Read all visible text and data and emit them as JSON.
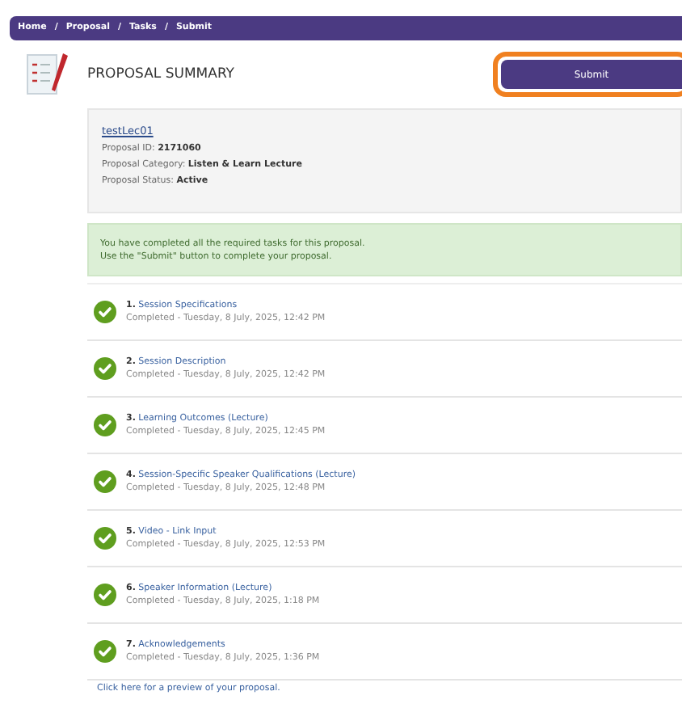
{
  "breadcrumb": [
    {
      "label": "Home",
      "separator": "/"
    },
    {
      "label": "Proposal",
      "separator": "/"
    },
    {
      "label": "Tasks",
      "separator": "/"
    },
    {
      "label": "Submit"
    }
  ],
  "title": "PROPOSAL SUMMARY",
  "submit": {
    "label": "Submit",
    "highlighted": true
  },
  "proposal": {
    "name": "testLec01",
    "fields": [
      {
        "label": "Proposal ID:",
        "value": "2171060"
      },
      {
        "label": "Proposal Category:",
        "value": "Listen & Learn Lecture"
      },
      {
        "label": "Proposal Status:",
        "value": "Active"
      }
    ]
  },
  "notice": [
    "You have completed all the required tasks for this proposal.",
    "Use the \"Submit\" button to complete your proposal."
  ],
  "tasks": [
    {
      "number": "1.",
      "title": "Session Specifications",
      "status": "Completed - Tuesday, 8 July, 2025, 12:42 PM",
      "completed": true
    },
    {
      "number": "2.",
      "title": "Session Description",
      "status": "Completed - Tuesday, 8 July, 2025, 12:42 PM",
      "completed": true
    },
    {
      "number": "3.",
      "title": "Learning Outcomes (Lecture)",
      "status": "Completed - Tuesday, 8 July, 2025, 12:45 PM",
      "completed": true
    },
    {
      "number": "4.",
      "title": "Session-Specific Speaker Qualifications (Lecture)",
      "status": "Completed - Tuesday, 8 July, 2025, 12:48 PM",
      "completed": true
    },
    {
      "number": "5.",
      "title": "Video - Link Input",
      "status": "Completed - Tuesday, 8 July, 2025, 12:53 PM",
      "completed": true
    },
    {
      "number": "6.",
      "title": "Speaker Information (Lecture)",
      "status": "Completed - Tuesday, 8 July, 2025, 1:18 PM",
      "completed": true
    },
    {
      "number": "7.",
      "title": "Acknowledgements",
      "status": "Completed - Tuesday, 8 July, 2025, 1:36 PM",
      "completed": true
    }
  ],
  "preview_link": "Click here for a preview of your proposal."
}
